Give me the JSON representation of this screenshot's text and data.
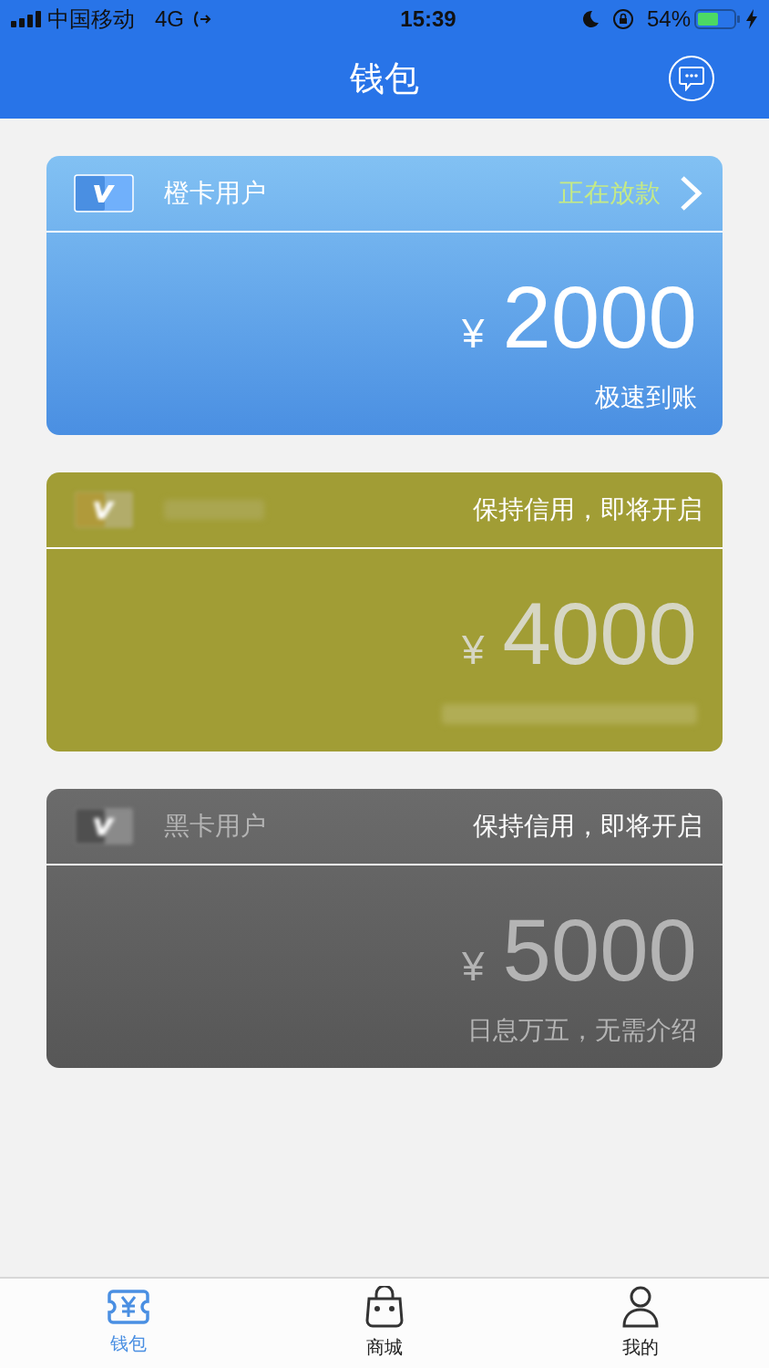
{
  "status_bar": {
    "carrier": "中国移动",
    "network": "4G",
    "time": "15:39",
    "battery": "54%"
  },
  "nav": {
    "title": "钱包"
  },
  "cards": [
    {
      "kind": "active",
      "name": "橙卡用户",
      "status": "正在放款",
      "currency": "¥",
      "amount": "2000",
      "note": "极速到账"
    },
    {
      "kind": "gold",
      "status": "保持信用，即将开启",
      "currency": "¥",
      "amount": "4000"
    },
    {
      "kind": "black",
      "name": "黑卡用户",
      "status": "保持信用，即将开启",
      "currency": "¥",
      "amount": "5000",
      "note": "日息万五，无需介绍"
    }
  ],
  "tabs": [
    {
      "label": "钱包",
      "selected": true
    },
    {
      "label": "商城",
      "selected": false
    },
    {
      "label": "我的",
      "selected": false
    }
  ]
}
